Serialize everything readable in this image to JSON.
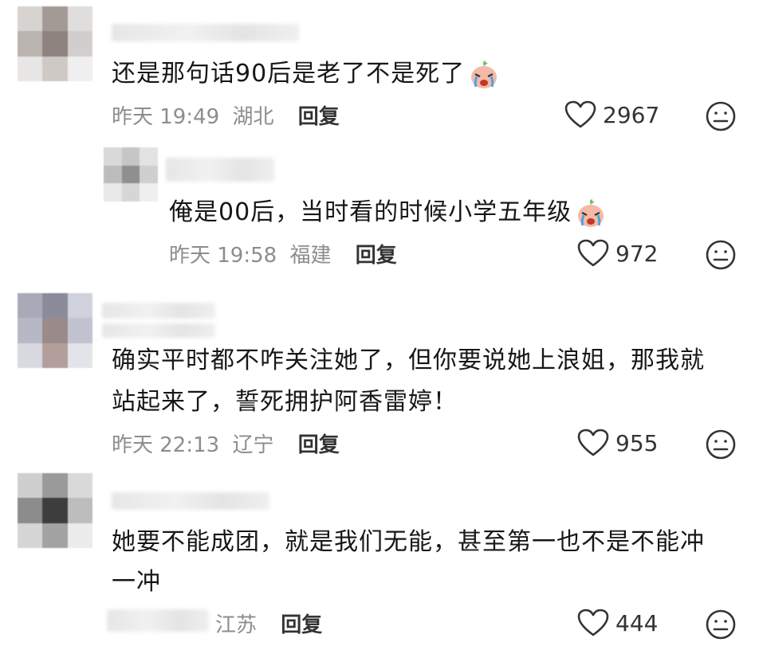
{
  "comments": [
    {
      "text": "还是那句话90后是老了不是死了",
      "emoji": "crying-face-emoji",
      "time": "昨天 19:49",
      "location": "湖北",
      "reply_label": "回复",
      "likes": "2967"
    },
    {
      "text": "俺是00后，当时看的时候小学五年级",
      "emoji": "crying-face-emoji",
      "time": "昨天 19:58",
      "location": "福建",
      "reply_label": "回复",
      "likes": "972"
    },
    {
      "text_line1": "确实平时都不咋关注她了，但你要说她上浪姐，那我就",
      "text_line2": "站起来了，誓死拥护阿香雷婷！",
      "time": "昨天 22:13",
      "location": "辽宁",
      "reply_label": "回复",
      "likes": "955"
    },
    {
      "text_line1": "她要不能成团，就是我们无能，甚至第一也不是不能冲",
      "text_line2": "一冲",
      "time": "",
      "location": "江苏",
      "reply_label": "回复",
      "likes": "444"
    }
  ],
  "icons": {
    "like": "heart-outline-icon",
    "dislike": "neutral-face-icon"
  },
  "colors": {
    "text": "#171717",
    "meta": "#8d8d8d",
    "icon": "#333333"
  }
}
